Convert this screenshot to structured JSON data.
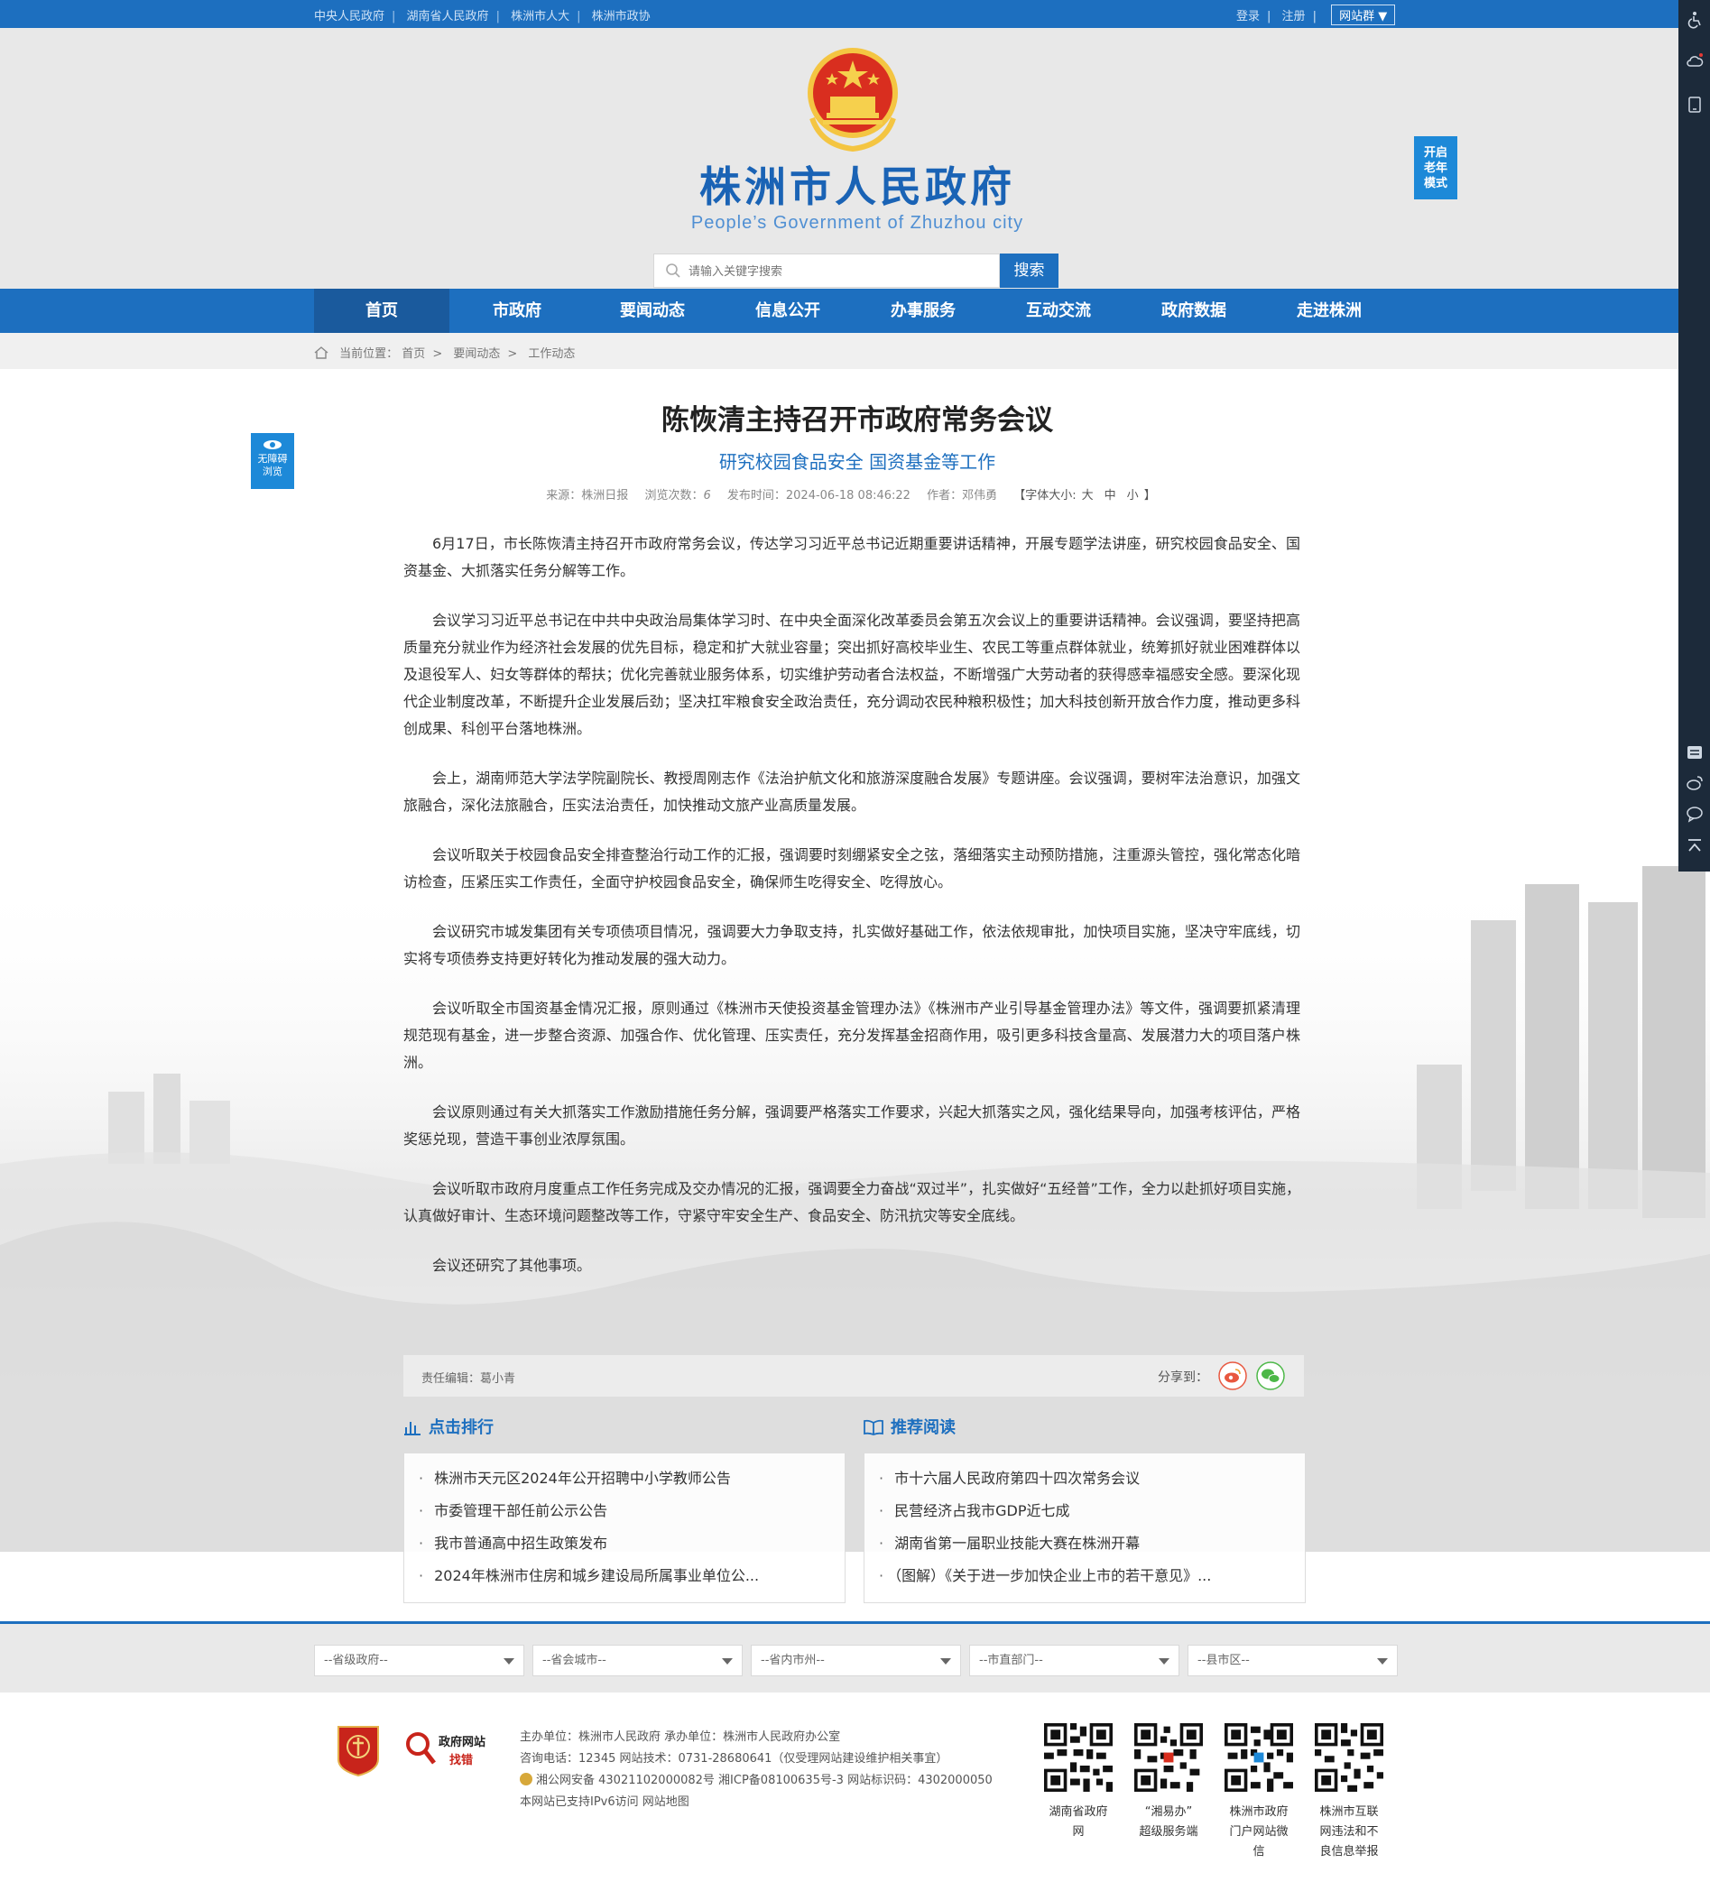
{
  "topbar": {
    "links": [
      "中央人民政府",
      "湖南省人民政府",
      "株洲市人大",
      "株洲市政协"
    ],
    "login": "登录",
    "register": "注册",
    "site_group": "网站群"
  },
  "header": {
    "title": "株洲市人民政府",
    "subtitle_en": "People’s Government of Zhuzhou city",
    "search_placeholder": "请输入关键字搜索",
    "search_button": "搜索",
    "elder_mode": [
      "开启",
      "老年",
      "模式"
    ]
  },
  "nav": [
    "首页",
    "市政府",
    "要闻动态",
    "信息公开",
    "办事服务",
    "互动交流",
    "政府数据",
    "走进株洲"
  ],
  "breadcrumb": {
    "prefix": "当前位置：",
    "items": [
      "首页",
      "要闻动态",
      "工作动态"
    ]
  },
  "accessibility": [
    "无障碍",
    "浏览"
  ],
  "article": {
    "title": "陈恢清主持召开市政府常务会议",
    "subtitle": "研究校园食品安全 国资基金等工作",
    "source": "来源：株洲日报",
    "views_label": "浏览次数：",
    "views": "6",
    "published": "发布时间：2024-06-18 08:46:22",
    "author": "作者：邓伟勇",
    "font_size_label": "【字体大小:",
    "font_sizes": [
      "大",
      "中",
      "小"
    ],
    "font_size_close": "】",
    "paragraphs": [
      "6月17日，市长陈恢清主持召开市政府常务会议，传达学习习近平总书记近期重要讲话精神，开展专题学法讲座，研究校园食品安全、国资基金、大抓落实任务分解等工作。",
      "会议学习习近平总书记在中共中央政治局集体学习时、在中央全面深化改革委员会第五次会议上的重要讲话精神。会议强调，要坚持把高质量充分就业作为经济社会发展的优先目标，稳定和扩大就业容量；突出抓好高校毕业生、农民工等重点群体就业，统筹抓好就业困难群体以及退役军人、妇女等群体的帮扶；优化完善就业服务体系，切实维护劳动者合法权益，不断增强广大劳动者的获得感幸福感安全感。要深化现代企业制度改革，不断提升企业发展后劲；坚决扛牢粮食安全政治责任，充分调动农民种粮积极性；加大科技创新开放合作力度，推动更多科创成果、科创平台落地株洲。",
      "会上，湖南师范大学法学院副院长、教授周刚志作《法治护航文化和旅游深度融合发展》专题讲座。会议强调，要树牢法治意识，加强文旅融合，深化法旅融合，压实法治责任，加快推动文旅产业高质量发展。",
      "会议听取关于校园食品安全排查整治行动工作的汇报，强调要时刻绷紧安全之弦，落细落实主动预防措施，注重源头管控，强化常态化暗访检查，压紧压实工作责任，全面守护校园食品安全，确保师生吃得安全、吃得放心。",
      "会议研究市城发集团有关专项债项目情况，强调要大力争取支持，扎实做好基础工作，依法依规审批，加快项目实施，坚决守牢底线，切实将专项债券支持更好转化为推动发展的强大动力。",
      "会议听取全市国资基金情况汇报，原则通过《株洲市天使投资基金管理办法》《株洲市产业引导基金管理办法》等文件，强调要抓紧清理规范现有基金，进一步整合资源、加强合作、优化管理、压实责任，充分发挥基金招商作用，吸引更多科技含量高、发展潜力大的项目落户株洲。",
      "会议原则通过有关大抓落实工作激励措施任务分解，强调要严格落实工作要求，兴起大抓落实之风，强化结果导向，加强考核评估，严格奖惩兑现，营造干事创业浓厚氛围。",
      "会议听取市政府月度重点工作任务完成及交办情况的汇报，强调要全力奋战“双过半”，扎实做好“五经普”工作，全力以赴抓好项目实施，认真做好审计、生态环境问题整改等工作，守紧守牢安全生产、食品安全、防汛抗灾等安全底线。",
      "会议还研究了其他事项。"
    ],
    "editor": "责任编辑：葛小青",
    "share_label": "分享到："
  },
  "rankings": {
    "title": "点击排行",
    "items": [
      "株洲市天元区2024年公开招聘中小学教师公告",
      "市委管理干部任前公示公告",
      "我市普通高中招生政策发布",
      "2024年株洲市住房和城乡建设局所属事业单位公..."
    ]
  },
  "recommended": {
    "title": "推荐阅读",
    "items": [
      "市十六届人民政府第四十四次常务会议",
      "民营经济占我市GDP近七成",
      "湖南省第一届职业技能大赛在株洲开幕",
      "（图解）《关于进一步加快企业上市的若干意见》..."
    ]
  },
  "selects": [
    "--省级政府--",
    "--省会城市--",
    "--省内市州--",
    "--市直部门--",
    "--县市区--"
  ],
  "footer": {
    "badge2": [
      "政府网站",
      "找错"
    ],
    "line1": "主办单位：株洲市人民政府   承办单位：株洲市人民政府办公室",
    "line2": "咨询电话：12345   网站技术：0731-28680641（仅受理网站建设维护相关事宜）",
    "line3": "湘公网安备 43021102000082号   湘ICP备08100635号-3   网站标识码：4302000050",
    "line4": "本网站已支持IPv6访问   网站地图",
    "qr_captions": [
      [
        "湖南省政府",
        "网"
      ],
      [
        "“湘易办”",
        "超级服务端"
      ],
      [
        "株洲市政府",
        "门户网站微",
        "信"
      ],
      [
        "株洲市互联",
        "网违法和不",
        "良信息举报"
      ]
    ]
  },
  "colors": {
    "brand_blue": "#1d6fbf",
    "nav_active": "#1a5a9d",
    "header_bg": "#e8e8e8"
  }
}
